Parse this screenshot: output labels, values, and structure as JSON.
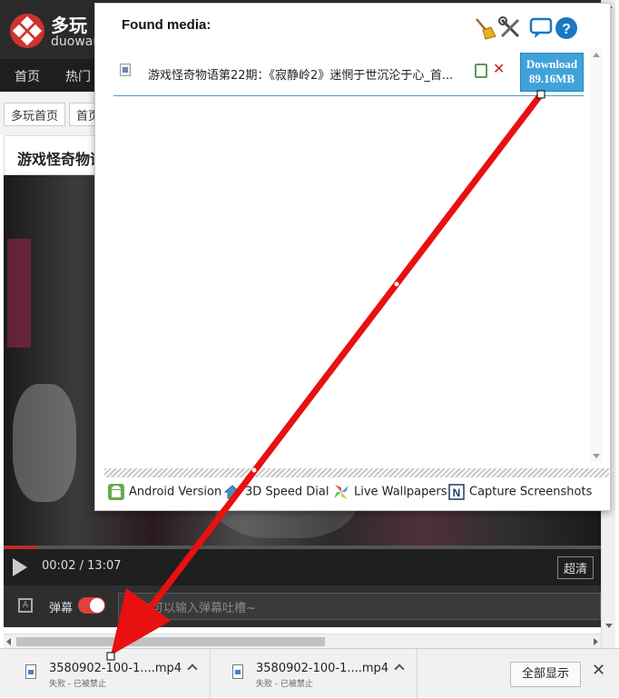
{
  "site": {
    "logo_text": "多玩",
    "logo_sub": "duowan",
    "nav": [
      "首页",
      "热门"
    ],
    "crumbs": [
      "多玩首页",
      "首页"
    ],
    "video_title": "游戏怪奇物语",
    "time": "00:02 / 13:07",
    "progress": 0.0025,
    "quality": "超清",
    "danmu_label": "弹幕",
    "danmu_placeholder": "点击可以输入弹幕吐槽~"
  },
  "popup": {
    "title": "Found media:",
    "tools": [
      "broom-icon",
      "tools-icon",
      "comment-icon",
      "help-icon"
    ],
    "media": {
      "name": "游戏怪奇物语第22期：《寂静岭2》迷惘于世沉沦于心_首...",
      "download_label": "Download",
      "download_size": "89.16MB"
    },
    "footer_links": [
      {
        "icon": "android-icon",
        "label": "Android Version"
      },
      {
        "icon": "house-icon",
        "label": "3D Speed Dial"
      },
      {
        "icon": "pinwheel-icon",
        "label": "Live Wallpapers"
      },
      {
        "icon": "capture-icon",
        "label": "Capture Screenshots"
      }
    ]
  },
  "downloads": {
    "items": [
      {
        "name": "3580902-100-1....mp4",
        "status": "失败 - 已被禁止"
      },
      {
        "name": "3580902-100-1....mp4",
        "status": "失败 - 已被禁止"
      }
    ],
    "show_all": "全部显示"
  },
  "colors": {
    "accent": "#3fa3d9",
    "annotation": "#e81010",
    "brand": "#d0322e"
  }
}
